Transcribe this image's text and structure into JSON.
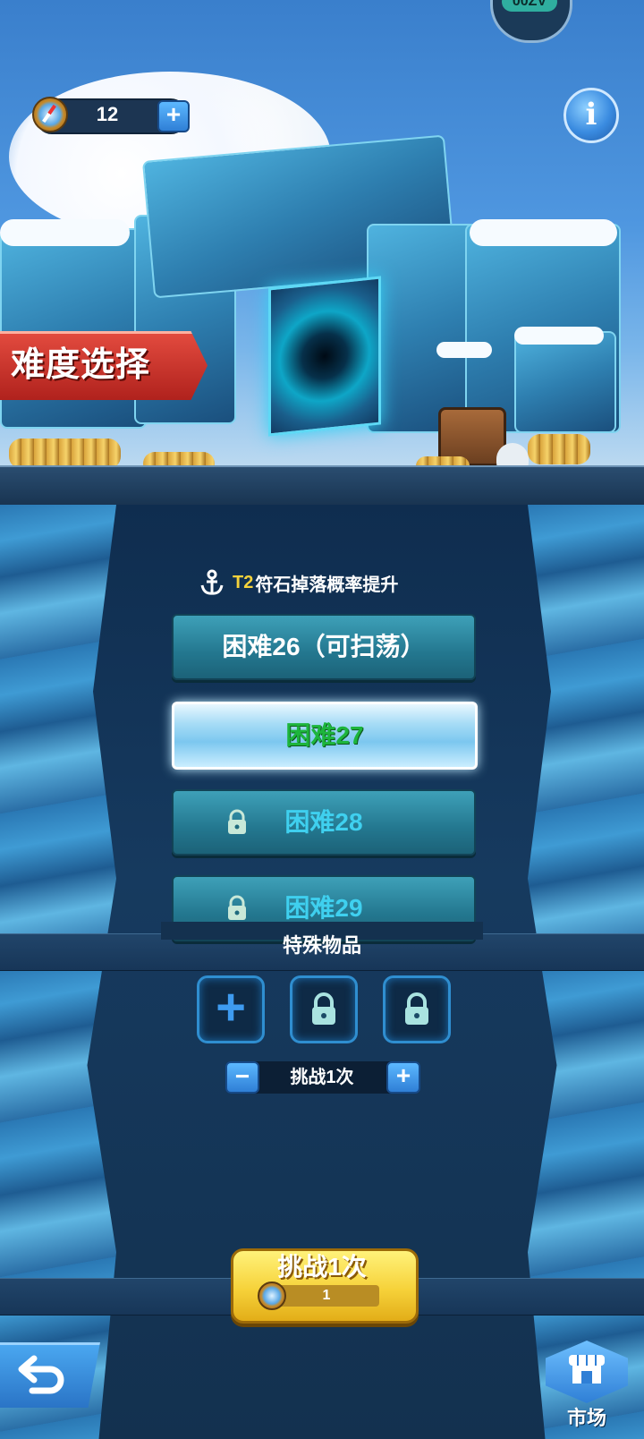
{
  "header": {
    "stamina_value": "12",
    "stamina_icon": "compass-icon",
    "add_label": "+",
    "info_label": "i",
    "top_badge_text": "00ZV"
  },
  "mode": {
    "difficulty_banner": "难度选择"
  },
  "bonus": {
    "tier": "T2",
    "text": "符石掉落概率提升",
    "icon": "anchor-icon"
  },
  "levels": [
    {
      "label": "困难26（可扫荡）",
      "state": "unlocked"
    },
    {
      "label": "困难27",
      "state": "selected"
    },
    {
      "label": "困难28",
      "state": "locked"
    },
    {
      "label": "困难29",
      "state": "locked"
    }
  ],
  "special_items": {
    "title": "特殊物品",
    "add_symbol": "+",
    "slots": [
      "add",
      "locked",
      "locked"
    ]
  },
  "count": {
    "minus": "−",
    "plus": "+",
    "text": "挑战1次"
  },
  "challenge": {
    "label": "挑战1次",
    "cost": "1"
  },
  "footer": {
    "market_label": "市场"
  },
  "colors": {
    "selected_level_text": "#1db53c",
    "locked_level_text": "#3fd0ef",
    "bonus_tier": "#f4d23b",
    "banner_red": "#c42b22",
    "challenge_yellow": "#f6d23a"
  }
}
